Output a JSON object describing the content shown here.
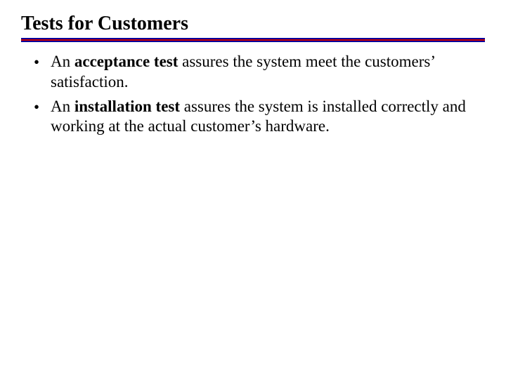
{
  "title": "Tests for Customers",
  "bullets": [
    {
      "pre": "An ",
      "bold": "acceptance test",
      "post": " assures the system meet the customers’ satisfaction."
    },
    {
      "pre": "An ",
      "bold": "installation test",
      "post": " assures the system is installed correctly and working at the actual customer’s hardware."
    }
  ],
  "bullet_marker": "•"
}
